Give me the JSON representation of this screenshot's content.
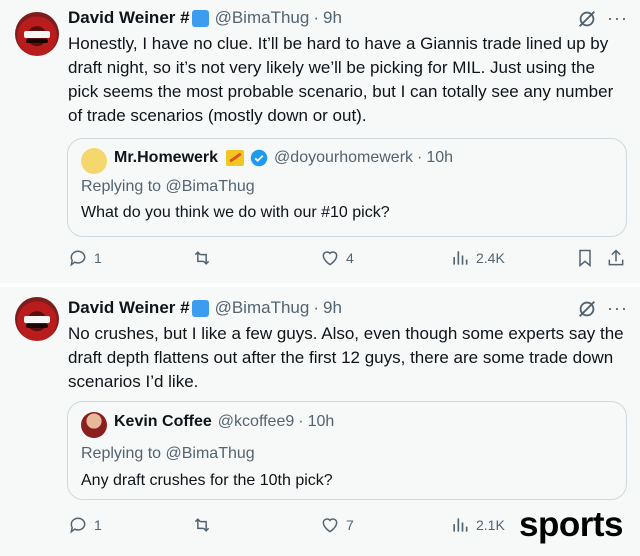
{
  "tweets": [
    {
      "author_name": "David Weiner #",
      "handle": "@BimaThug",
      "separator": "·",
      "time": "9h",
      "text": "Honestly, I have no clue. It’ll be hard to have a Giannis trade lined up by draft night, so it’s not very likely we’ll be picking for MIL. Just using the pick seems the most probable scenario, but I can totally see any number of trade scenarios (mostly down or out).",
      "quote": {
        "author_name": "Mr.Homewerk",
        "handle": "@doyourhomewerk",
        "separator": "·",
        "time": "10h",
        "replying_to": "Replying to @BimaThug",
        "text": "What do you think we do with our #10 pick?"
      },
      "stats": {
        "replies": "1",
        "retweets": "",
        "likes": "4",
        "views": "2.4K"
      }
    },
    {
      "author_name": "David Weiner #",
      "handle": "@BimaThug",
      "separator": "·",
      "time": "9h",
      "text": "No crushes, but I like a few guys. Also, even though some experts say the draft depth flattens out after the first 12 guys, there are some trade down scenarios I’d like.",
      "quote": {
        "author_name": "Kevin Coffee",
        "handle": "@kcoffee9",
        "separator": "·",
        "time": "10h",
        "replying_to": "Replying to @BimaThug",
        "text": "Any draft crushes for the 10th pick?"
      },
      "stats": {
        "replies": "1",
        "retweets": "",
        "likes": "7",
        "views": "2.1K"
      }
    }
  ],
  "watermark": "sports",
  "colors": {
    "text": "#0f1419",
    "muted": "#536471",
    "verified": "#1d9bf0",
    "border": "#cfd9de",
    "background": "#f7f9f9"
  },
  "icons": [
    "grok-icon",
    "more-icon",
    "reply-icon",
    "retweet-icon",
    "like-icon",
    "views-icon",
    "bookmark-icon",
    "share-icon",
    "verified-badge-icon",
    "pencil-emoji-icon"
  ]
}
